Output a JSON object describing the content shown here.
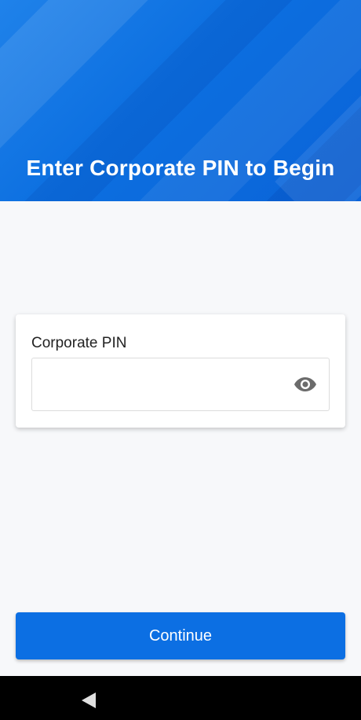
{
  "header": {
    "title": "Enter Corporate PIN to Begin"
  },
  "pin_card": {
    "label": "Corporate PIN",
    "value": "",
    "placeholder": "",
    "visibility_icon": "eye-icon"
  },
  "actions": {
    "continue_label": "Continue"
  },
  "nav": {
    "back_icon": "back-triangle-icon"
  },
  "colors": {
    "primary": "#0c6fe3",
    "header": "#1f82ea",
    "background": "#f7f8fa"
  }
}
